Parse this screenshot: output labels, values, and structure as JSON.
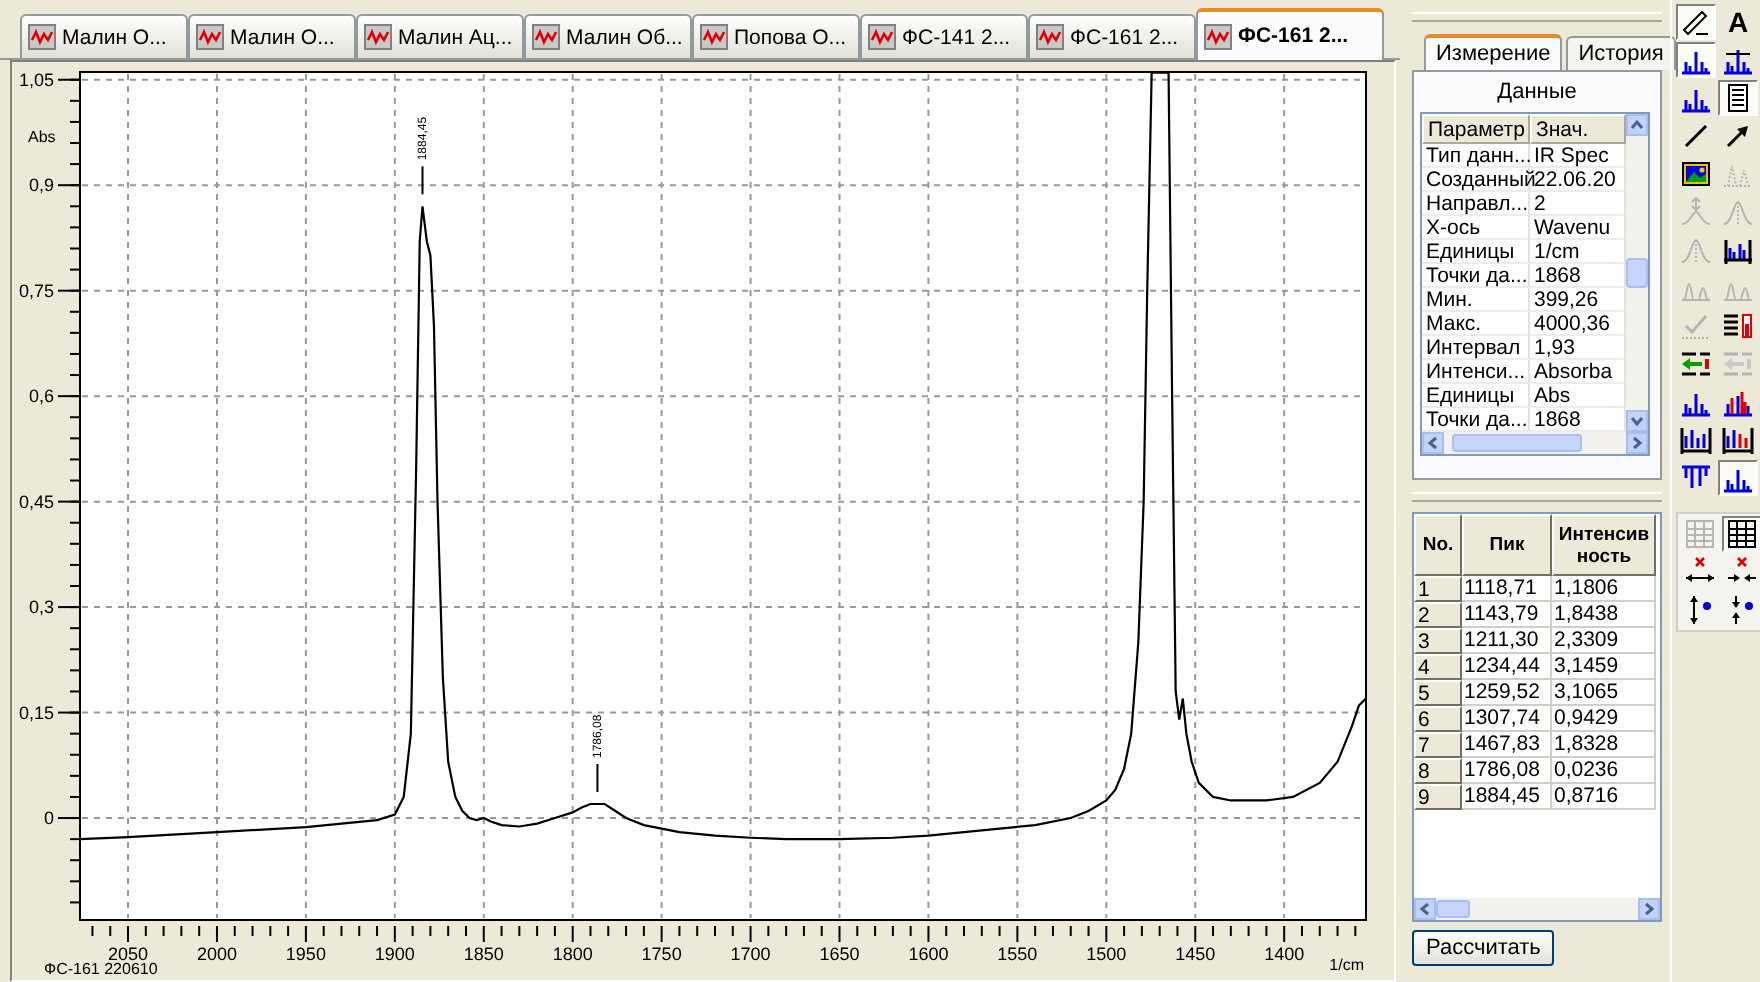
{
  "tabs": [
    {
      "label": "Малин О...",
      "selected": false
    },
    {
      "label": "Малин О...",
      "selected": false
    },
    {
      "label": "Малин Ац...",
      "selected": false
    },
    {
      "label": "Малин Об...",
      "selected": false
    },
    {
      "label": "Попова О...",
      "selected": false
    },
    {
      "label": "ФС-141 2...",
      "selected": false
    },
    {
      "label": "ФС-161 2...",
      "selected": false
    },
    {
      "label": "ФС-161 2...",
      "selected": true
    }
  ],
  "chart": {
    "caption": "ФС-161 220610",
    "chart_data": {
      "type": "line",
      "grid": true,
      "xlabel": "1/cm",
      "ylabel": "Abs",
      "xlim": [
        2077,
        1354
      ],
      "ylim": [
        -0.145,
        1.061
      ],
      "xticks": [
        2050,
        2000,
        1950,
        1900,
        1850,
        1800,
        1750,
        1700,
        1650,
        1600,
        1550,
        1500,
        1450,
        1400
      ],
      "yticks": [
        {
          "value": 0,
          "label": "0"
        },
        {
          "value": 0.15,
          "label": "0,15"
        },
        {
          "value": 0.3,
          "label": "0,3"
        },
        {
          "value": 0.45,
          "label": "0,45"
        },
        {
          "value": 0.6,
          "label": "0,6"
        },
        {
          "value": 0.75,
          "label": "0,75"
        },
        {
          "value": 0.9,
          "label": "0,9"
        },
        {
          "value": 1.05,
          "label": "1,05"
        }
      ],
      "x": [
        2077,
        2050,
        2000,
        1950,
        1910,
        1900,
        1895,
        1891,
        1888,
        1886,
        1884.45,
        1882,
        1880,
        1878,
        1876,
        1873,
        1870,
        1866,
        1862,
        1858,
        1854,
        1850,
        1846,
        1840,
        1830,
        1820,
        1810,
        1800,
        1795,
        1790,
        1786.08,
        1782,
        1776,
        1770,
        1760,
        1740,
        1720,
        1700,
        1680,
        1650,
        1620,
        1600,
        1580,
        1560,
        1540,
        1520,
        1510,
        1500,
        1495,
        1490,
        1486,
        1482,
        1479,
        1477,
        1474.5,
        1465,
        1463,
        1461,
        1459,
        1457,
        1455,
        1452,
        1448,
        1440,
        1430,
        1410,
        1395,
        1380,
        1370,
        1362,
        1358,
        1354
      ],
      "series": [
        {
          "color": "#000000",
          "values": [
            -0.03,
            -0.027,
            -0.02,
            -0.013,
            -0.003,
            0.005,
            0.03,
            0.12,
            0.5,
            0.82,
            0.87,
            0.82,
            0.8,
            0.7,
            0.45,
            0.2,
            0.08,
            0.03,
            0.01,
            0,
            -0.003,
            0,
            -0.005,
            -0.01,
            -0.012,
            -0.008,
            0,
            0.008,
            0.015,
            0.02,
            0.02,
            0.02,
            0.01,
            0,
            -0.01,
            -0.02,
            -0.025,
            -0.028,
            -0.03,
            -0.03,
            -0.028,
            -0.025,
            -0.02,
            -0.015,
            -0.01,
            0,
            0.01,
            0.025,
            0.04,
            0.07,
            0.12,
            0.25,
            0.45,
            0.75,
            1.06,
            1.06,
            0.6,
            0.18,
            0.14,
            0.17,
            0.12,
            0.08,
            0.05,
            0.03,
            0.025,
            0.025,
            0.03,
            0.05,
            0.08,
            0.13,
            0.16,
            0.17
          ]
        }
      ],
      "annotations": [
        {
          "x": 1884.45,
          "y": 0.87,
          "text": "1884,45"
        },
        {
          "x": 1786.08,
          "y": 0.02,
          "text": "1786,08"
        }
      ]
    }
  },
  "side_panel": {
    "tabs": [
      {
        "label": "Измерение",
        "selected": true
      },
      {
        "label": "История",
        "selected": false
      }
    ],
    "title": "Данные",
    "columns": [
      "Параметр",
      "Знач."
    ],
    "rows": [
      [
        "Тип данн...",
        "IR Spec"
      ],
      [
        "Созданный",
        "22.06.20"
      ],
      [
        "Направл...",
        "2"
      ],
      [
        "X-ось",
        "Wavenu"
      ],
      [
        "Единицы",
        "1/cm"
      ],
      [
        "Точки да...",
        "1868"
      ],
      [
        "Мин.",
        "399,26"
      ],
      [
        "Макс.",
        "4000,36"
      ],
      [
        "Интервал",
        "1,93"
      ],
      [
        "Интенси...",
        "Absorba"
      ],
      [
        "Единицы",
        "Abs"
      ],
      [
        "Точки да...",
        "1868"
      ]
    ]
  },
  "peaks": {
    "columns": [
      "No.",
      "Пик",
      "Интенсив ность"
    ],
    "rows": [
      [
        "1",
        "1118,71",
        "1,1806"
      ],
      [
        "2",
        "1143,79",
        "1,8438"
      ],
      [
        "3",
        "1211,30",
        "2,3309"
      ],
      [
        "4",
        "1234,44",
        "3,1459"
      ],
      [
        "5",
        "1259,52",
        "3,1065"
      ],
      [
        "6",
        "1307,74",
        "0,9429"
      ],
      [
        "7",
        "1467,83",
        "1,8328"
      ],
      [
        "8",
        "1786,08",
        "0,0236"
      ],
      [
        "9",
        "1884,45",
        "0,8716"
      ]
    ],
    "button": "Рассчитать"
  },
  "toolbar": [
    {
      "kind": "pen",
      "pressed": true,
      "disabled": false
    },
    {
      "kind": "text",
      "label": "A",
      "pressed": false,
      "disabled": false
    },
    {
      "kind": "peaks",
      "pressed": true,
      "disabled": false
    },
    {
      "kind": "peaks-baseline",
      "pressed": false,
      "disabled": false
    },
    {
      "kind": "peaks",
      "pressed": false,
      "disabled": false
    },
    {
      "kind": "document",
      "pressed": true,
      "disabled": false
    },
    {
      "kind": "line",
      "pressed": false,
      "disabled": false
    },
    {
      "kind": "arrow",
      "pressed": false,
      "disabled": false
    },
    {
      "kind": "image",
      "pressed": false,
      "disabled": false
    },
    {
      "kind": "dotted-peaks",
      "pressed": false,
      "disabled": true
    },
    {
      "kind": "peak-marker",
      "pressed": false,
      "disabled": true
    },
    {
      "kind": "peak-curve",
      "pressed": false,
      "disabled": true
    },
    {
      "kind": "peak-curve",
      "pressed": false,
      "disabled": true
    },
    {
      "kind": "bracket-peaks",
      "pressed": false,
      "disabled": false
    },
    {
      "kind": "twin-peaks",
      "pressed": false,
      "disabled": true
    },
    {
      "kind": "twin-peaks",
      "pressed": false,
      "disabled": true
    },
    {
      "kind": "check",
      "pressed": false,
      "disabled": true
    },
    {
      "kind": "list-red",
      "pressed": false,
      "disabled": false
    },
    {
      "kind": "list-arrow",
      "pressed": false,
      "disabled": false
    },
    {
      "kind": "list-arrow",
      "pressed": false,
      "disabled": true
    },
    {
      "kind": "peaks",
      "pressed": false,
      "disabled": false
    },
    {
      "kind": "peaks-overlay",
      "pressed": false,
      "disabled": false
    },
    {
      "kind": "peaks-range",
      "pressed": false,
      "disabled": false
    },
    {
      "kind": "peaks-range-red",
      "pressed": false,
      "disabled": false
    },
    {
      "kind": "dip",
      "pressed": false,
      "disabled": false
    },
    {
      "kind": "peaks",
      "pressed": true,
      "disabled": false
    }
  ],
  "toolbar_lower": [
    {
      "kind": "grid",
      "pressed": false,
      "disabled": true
    },
    {
      "kind": "grid",
      "pressed": true,
      "disabled": false
    },
    {
      "kind": "x-range",
      "pressed": false,
      "disabled": false
    },
    {
      "kind": "x-inward",
      "pressed": false,
      "disabled": false
    },
    {
      "kind": "y-range",
      "pressed": false,
      "disabled": false
    },
    {
      "kind": "y-inward",
      "pressed": false,
      "disabled": false
    }
  ]
}
